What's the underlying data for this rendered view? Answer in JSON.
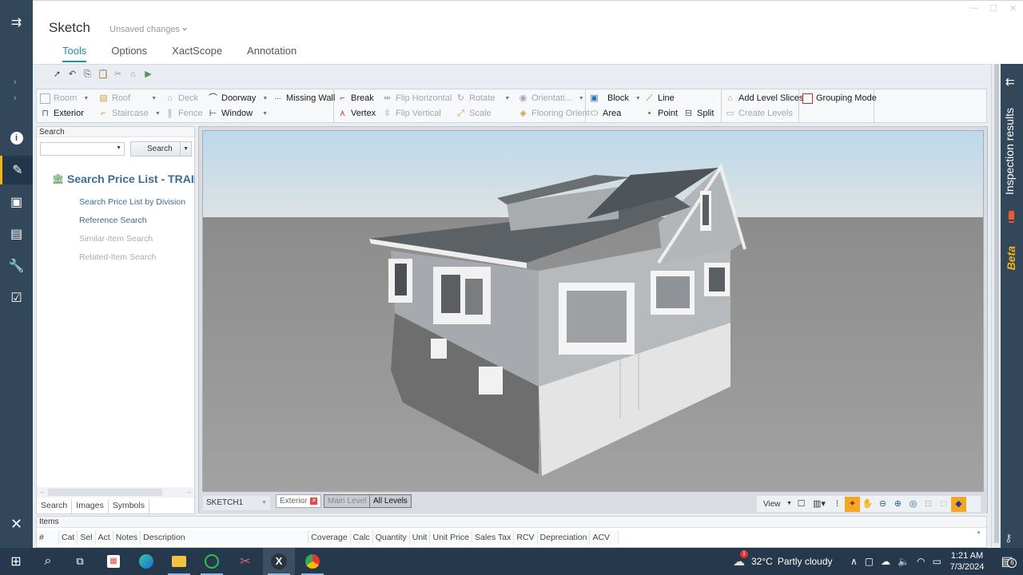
{
  "window": {
    "title": "Sketch",
    "status": "Unsaved changes",
    "controls": {
      "minimize": "—",
      "maximize": "☐",
      "close": "✕"
    }
  },
  "tabs": [
    {
      "label": "Tools",
      "active": true
    },
    {
      "label": "Options",
      "active": false
    },
    {
      "label": "XactScope",
      "active": false
    },
    {
      "label": "Annotation",
      "active": false
    }
  ],
  "quick_toolbar": [
    "select-pointer",
    "undo",
    "copy",
    "paste",
    "cut",
    "stamp",
    "export"
  ],
  "ribbon": {
    "groups": [
      {
        "name": "create",
        "items": [
          {
            "label": "Room",
            "icon": "room-icon",
            "enabled": false,
            "dropdown": true
          },
          {
            "label": "Roof",
            "icon": "roof-icon",
            "enabled": false,
            "dropdown": true
          },
          {
            "label": "Deck",
            "icon": "deck-icon",
            "enabled": false
          },
          {
            "label": "Doorway",
            "icon": "doorway-icon",
            "enabled": true,
            "dropdown": true
          },
          {
            "label": "Missing Wall",
            "icon": "missing-wall-icon",
            "enabled": true
          },
          {
            "label": "Exterior",
            "icon": "exterior-icon",
            "enabled": true
          },
          {
            "label": "Staircase",
            "icon": "staircase-icon",
            "enabled": false,
            "dropdown": true
          },
          {
            "label": "Fence",
            "icon": "fence-icon",
            "enabled": false
          },
          {
            "label": "Window",
            "icon": "window-icon",
            "enabled": true,
            "dropdown": true
          }
        ]
      },
      {
        "name": "edit",
        "items": [
          {
            "label": "Break",
            "icon": "break-icon",
            "enabled": true
          },
          {
            "label": "Flip Horizontal",
            "icon": "flip-horizontal-icon",
            "enabled": false
          },
          {
            "label": "Rotate",
            "icon": "rotate-icon",
            "enabled": false,
            "dropdown": true
          },
          {
            "label": "Orientati...",
            "icon": "orientation-icon",
            "enabled": false,
            "dropdown": true
          },
          {
            "label": "Vertex",
            "icon": "vertex-icon",
            "enabled": true
          },
          {
            "label": "Flip Vertical",
            "icon": "flip-vertical-icon",
            "enabled": false
          },
          {
            "label": "Scale",
            "icon": "scale-icon",
            "enabled": false
          },
          {
            "label": "Flooring Orient",
            "icon": "flooring-orientation-icon",
            "enabled": false
          }
        ]
      },
      {
        "name": "shapes",
        "items": [
          {
            "label": "Block",
            "icon": "block-icon",
            "enabled": true,
            "dropdown": true
          },
          {
            "label": "Line",
            "icon": "line-icon",
            "enabled": true
          },
          {
            "label": "Area",
            "icon": "area-icon",
            "enabled": true
          },
          {
            "label": "Point",
            "icon": "point-icon",
            "enabled": true
          },
          {
            "label": "Split",
            "icon": "split-icon",
            "enabled": true
          }
        ]
      },
      {
        "name": "levels",
        "items": [
          {
            "label": "Add Level Slices",
            "icon": "add-level-slices-icon",
            "enabled": true
          },
          {
            "label": "Create Levels",
            "icon": "create-levels-icon",
            "enabled": false
          }
        ]
      },
      {
        "name": "grouping",
        "items": [
          {
            "label": "Grouping Mode",
            "icon": "grouping-mode-icon",
            "enabled": true
          }
        ]
      }
    ]
  },
  "search_pane": {
    "header": "Search",
    "input_value": "",
    "search_button": "Search",
    "title": "Search Price List - TRAINI",
    "links": [
      {
        "label": "Search Price List by Division",
        "enabled": true
      },
      {
        "label": "Reference Search",
        "enabled": true
      },
      {
        "label": "Similar-Item Search",
        "enabled": false
      },
      {
        "label": "Related-Item Search",
        "enabled": false
      }
    ],
    "tabs": [
      {
        "label": "Search",
        "active": true
      },
      {
        "label": "Images",
        "active": false
      },
      {
        "label": "Symbols",
        "active": false
      }
    ]
  },
  "viewport": {
    "sketch_select": "SKETCH1",
    "level_tabs": [
      {
        "label": "Exterior",
        "closable": true
      },
      {
        "label": "Main Level",
        "closable": false
      },
      {
        "label": "All Levels",
        "closable": false
      }
    ],
    "view_dropdown": "View",
    "view_tools": [
      "single-view",
      "layout",
      "footprints",
      "center",
      "pan",
      "zoom-out",
      "zoom-in",
      "zoom-fit",
      "zoom-window",
      "blank",
      "3d-view"
    ],
    "colors": {
      "sky_top": "#bcd8ec",
      "ground": "#8c8c8c",
      "roof": "#5e6368",
      "siding": "#b9bcc0",
      "foundation": "#e6e6e6",
      "active_tool": "#f5a623"
    }
  },
  "items_grid": {
    "header": "Items",
    "columns": [
      "#",
      "Cat",
      "Sel",
      "Act",
      "Notes",
      "Description",
      "Coverage",
      "Calc",
      "Quantity",
      "Unit",
      "Unit Price",
      "Sales Tax",
      "RCV",
      "Depreciation",
      "ACV"
    ],
    "rows": []
  },
  "left_rail": {
    "items": [
      "info",
      "sketch",
      "photos",
      "documents",
      "tools",
      "checklist"
    ],
    "active": "sketch",
    "accent": "#f0b41c"
  },
  "right_rail": {
    "label": "Inspection results",
    "badge": "Beta"
  },
  "taskbar": {
    "apps": [
      "start",
      "search",
      "task-view",
      "microsoft-store",
      "edge",
      "file-explorer",
      "whatsapp",
      "snipping-tool",
      "xactimate",
      "chrome"
    ],
    "weather": {
      "temp": "32°C",
      "condition": "Partly cloudy",
      "badge": "1"
    },
    "time": "1:21 AM",
    "date": "7/3/2024",
    "notifications": "6"
  }
}
